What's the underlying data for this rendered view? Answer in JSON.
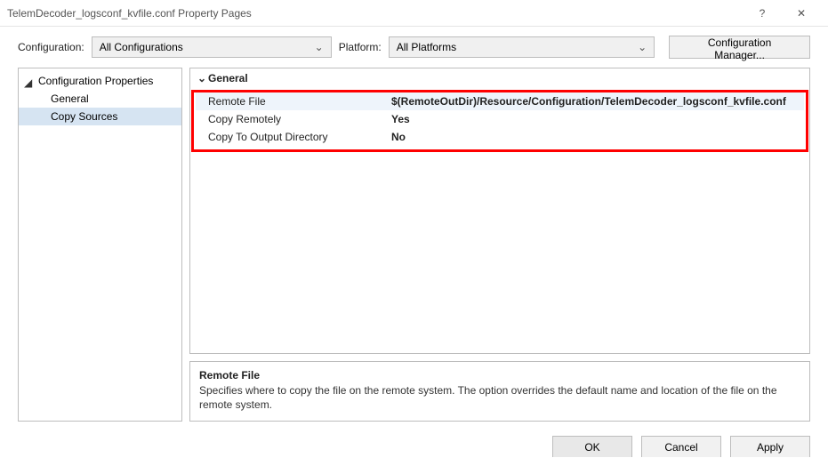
{
  "window": {
    "title": "TelemDecoder_logsconf_kvfile.conf Property Pages",
    "help_icon": "?",
    "close_icon": "✕"
  },
  "toolbar": {
    "configuration_label": "Configuration:",
    "configuration_value": "All Configurations",
    "platform_label": "Platform:",
    "platform_value": "All Platforms",
    "cfgmgr_label": "Configuration Manager..."
  },
  "tree": {
    "root": "Configuration Properties",
    "items": [
      {
        "label": "General",
        "selected": false
      },
      {
        "label": "Copy Sources",
        "selected": true
      }
    ]
  },
  "grid": {
    "section": "General",
    "rows": [
      {
        "key": "Remote File",
        "value": "$(RemoteOutDir)/Resource/Configuration/TelemDecoder_logsconf_kvfile.conf",
        "selected": true,
        "boldValue": true
      },
      {
        "key": "Copy Remotely",
        "value": "Yes",
        "selected": false,
        "boldValue": true
      },
      {
        "key": "Copy To Output Directory",
        "value": "No",
        "selected": false,
        "boldValue": true
      }
    ]
  },
  "description": {
    "heading": "Remote File",
    "body": "Specifies where to copy the file on the remote system. The option overrides the default name and location of the file on the remote system."
  },
  "footer": {
    "ok": "OK",
    "cancel": "Cancel",
    "apply": "Apply"
  }
}
